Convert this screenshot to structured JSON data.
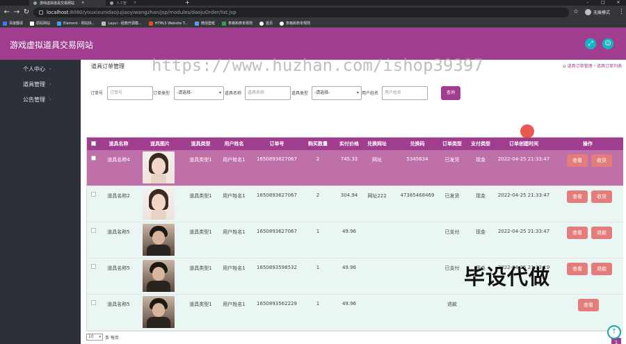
{
  "browser": {
    "tabs": [
      {
        "title": "游戏虚拟道具交易网站"
      },
      {
        "title": "人工智"
      }
    ],
    "url_host": "localhost",
    "url_path": ":8080/youxixunidaojujiaoyiwangzhan/jsp/modules/daojuOrder/list.jsp",
    "profile_label": "无痕模式",
    "bookmarks": [
      "百度翻译",
      "原码网站",
      "Element - 网站快...",
      "Layui - 经典开源模...",
      "HTML5 Website T...",
      "微信壁纸",
      "表格和表单规则",
      "首页",
      "表格和表单规则"
    ]
  },
  "app": {
    "title": "游戏虚拟道具交易网站",
    "header_icons": [
      "expand-icon",
      "user-icon"
    ]
  },
  "sidebar": {
    "items": [
      {
        "label": "个人中心"
      },
      {
        "label": "道具管理"
      },
      {
        "label": "公告管理"
      }
    ]
  },
  "page": {
    "title": "道具订单管理",
    "breadcrumb": [
      "道具订单管理",
      "道具订单列表"
    ],
    "watermark": "https://www.huzhan.com/ishop39397",
    "overlay_text": "毕设代做"
  },
  "filters": {
    "order_no_label": "订单号",
    "order_no_placeholder": "订单号",
    "order_type_label": "订单类型",
    "order_type_value": "-请选择-",
    "item_name_label": "道具名称",
    "item_name_placeholder": "道具名称",
    "item_type_label": "道具类型",
    "item_type_value": "-请选择-",
    "user_name_label": "用户姓名",
    "user_name_placeholder": "用户姓名",
    "search_button": "查询"
  },
  "table": {
    "headers": [
      "道具名称",
      "道具图片",
      "道具类型",
      "用户姓名",
      "订单号",
      "购买数量",
      "实付价格",
      "兑换网址",
      "兑换码",
      "订单类型",
      "支付类型",
      "订单创建时间",
      "操作"
    ],
    "rows": [
      {
        "name": "道具名称4",
        "img": "female",
        "type": "道具类型1",
        "user": "用户姓名1",
        "order_no": "1650893627067",
        "qty": "2",
        "price": "745.33",
        "url": "网址",
        "code": "5345634",
        "status": "已发货",
        "pay": "现金",
        "time": "2022-04-25 21:33:47",
        "actions": [
          "查看",
          "收货"
        ]
      },
      {
        "name": "道具名称2",
        "img": "female",
        "type": "道具类型1",
        "user": "用户姓名1",
        "order_no": "1650893627067",
        "qty": "2",
        "price": "304.94",
        "url": "网址222",
        "code": "47385468469",
        "status": "已发货",
        "pay": "现金",
        "time": "2022-04-25 21:33:47",
        "actions": [
          "查看",
          "收货"
        ]
      },
      {
        "name": "道具名称5",
        "img": "male",
        "type": "道具类型1",
        "user": "用户姓名1",
        "order_no": "1650893627067",
        "qty": "1",
        "price": "49.96",
        "url": "",
        "code": "",
        "status": "已支付",
        "pay": "现金",
        "time": "2022-04-25 21:33:47",
        "actions": [
          "查看",
          "退款"
        ]
      },
      {
        "name": "道具名称5",
        "img": "male",
        "type": "道具类型1",
        "user": "用户姓名1",
        "order_no": "1650893598532",
        "qty": "1",
        "price": "49.96",
        "url": "",
        "code": "",
        "status": "已支付",
        "pay": "现金",
        "time": "2022-04-25 21:33:19",
        "actions": [
          "查看",
          "退款"
        ]
      },
      {
        "name": "道具名称5",
        "img": "male",
        "type": "道具类型1",
        "user": "用户姓名1",
        "order_no": "1650893562229",
        "qty": "1",
        "price": "49.96",
        "url": "",
        "code": "",
        "status": "退款",
        "pay": "",
        "time": "",
        "actions": [
          "查看"
        ]
      }
    ]
  },
  "pager": {
    "page_size": "10",
    "per_page_label": "条 每页",
    "current_page": "1"
  },
  "colors": {
    "brand": "#a03d8e",
    "sidebar": "#2d3038",
    "row_bg": "#eaf6f4",
    "button": "#e27d7c",
    "accent_round": "#14b5c0"
  }
}
